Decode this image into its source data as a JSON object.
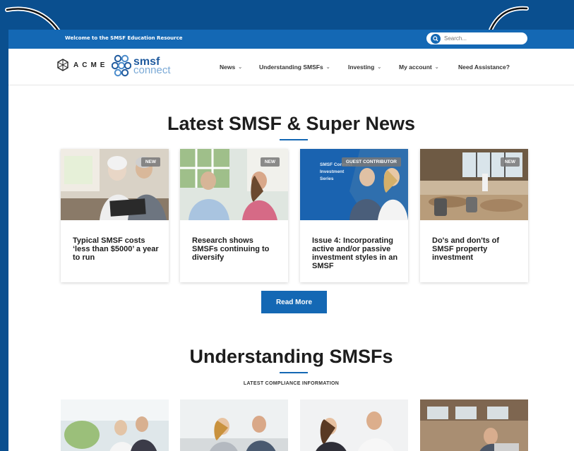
{
  "topbar": {
    "welcome": "Welcome to the SMSF Education Resource",
    "search_placeholder": "Search..."
  },
  "brand": {
    "acme": "ACME",
    "smsf_line1": "smsf",
    "smsf_line2": "connect"
  },
  "nav": {
    "items": [
      {
        "label": "News",
        "dropdown": true
      },
      {
        "label": "Understanding SMSFs",
        "dropdown": true
      },
      {
        "label": "Investing",
        "dropdown": true
      },
      {
        "label": "My account",
        "dropdown": true
      },
      {
        "label": "Need Assistance?",
        "dropdown": false
      }
    ]
  },
  "news": {
    "heading": "Latest SMSF & Super News",
    "cards": [
      {
        "badge": "NEW",
        "title": "Typical SMSF costs ‘less than $5000’ a year to run"
      },
      {
        "badge": "NEW",
        "title": "Research shows SMSFs continuing to diversify"
      },
      {
        "badge": "GUEST CONTRIBUTOR",
        "title": "Issue 4: Incorporating active and/or passive investment styles in an SMSF",
        "image_text": "SMSF Connect Investment Series"
      },
      {
        "badge": "NEW",
        "title": "Do's and don'ts of SMSF property investment"
      }
    ],
    "read_more": "Read More"
  },
  "understanding": {
    "heading": "Understanding SMSFs",
    "subheading": "LATEST COMPLIANCE INFORMATION"
  },
  "colors": {
    "brand_blue": "#1468b4",
    "outer_blue": "#0a4f8f"
  }
}
